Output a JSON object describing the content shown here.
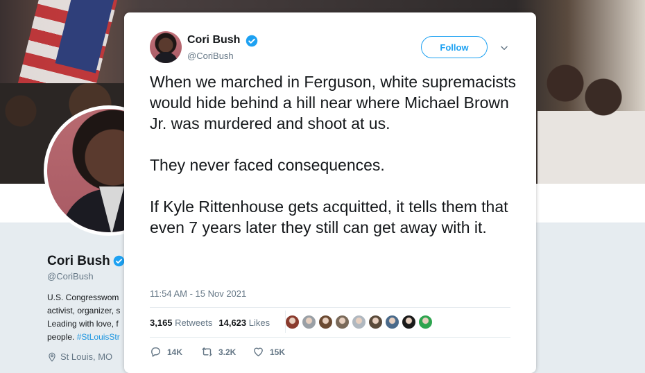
{
  "profile": {
    "name": "Cori Bush",
    "handle": "@CoriBush",
    "bio_lines": [
      "U.S. Congresswom",
      "activist, organizer, s",
      "Leading with love, f"
    ],
    "bio_last_prefix": "people. ",
    "bio_hashtag": "#StLouisStr",
    "location": "St Louis, MO"
  },
  "tweet": {
    "author_name": "Cori Bush",
    "author_handle": "@CoriBush",
    "follow_label": "Follow",
    "paragraphs": [
      "When we marched in Ferguson, white supremacists would hide behind a hill near where Michael Brown Jr. was murdered and shoot at us.",
      "They never faced consequences.",
      "If Kyle Rittenhouse gets acquitted, it tells them that even 7 years later they still can get away with it."
    ],
    "timestamp": "11:54 AM - 15 Nov 2021",
    "retweets_count": "3,165",
    "retweets_label": "Retweets",
    "likes_count": "14,623",
    "likes_label": "Likes",
    "replies": "14K",
    "retweets_short": "3.2K",
    "likes_short": "15K"
  },
  "colors": {
    "accent": "#1da1f2",
    "verified": "#1da1f2",
    "text": "#14171a",
    "secondary": "#657786"
  },
  "likers": [
    "#8a3b2e",
    "#9aa0a6",
    "#6b4a32",
    "#7a6a5a",
    "#b0b8c0",
    "#5a4a3a",
    "#4a6a8a",
    "#1a1a1a",
    "#2ea44f"
  ]
}
